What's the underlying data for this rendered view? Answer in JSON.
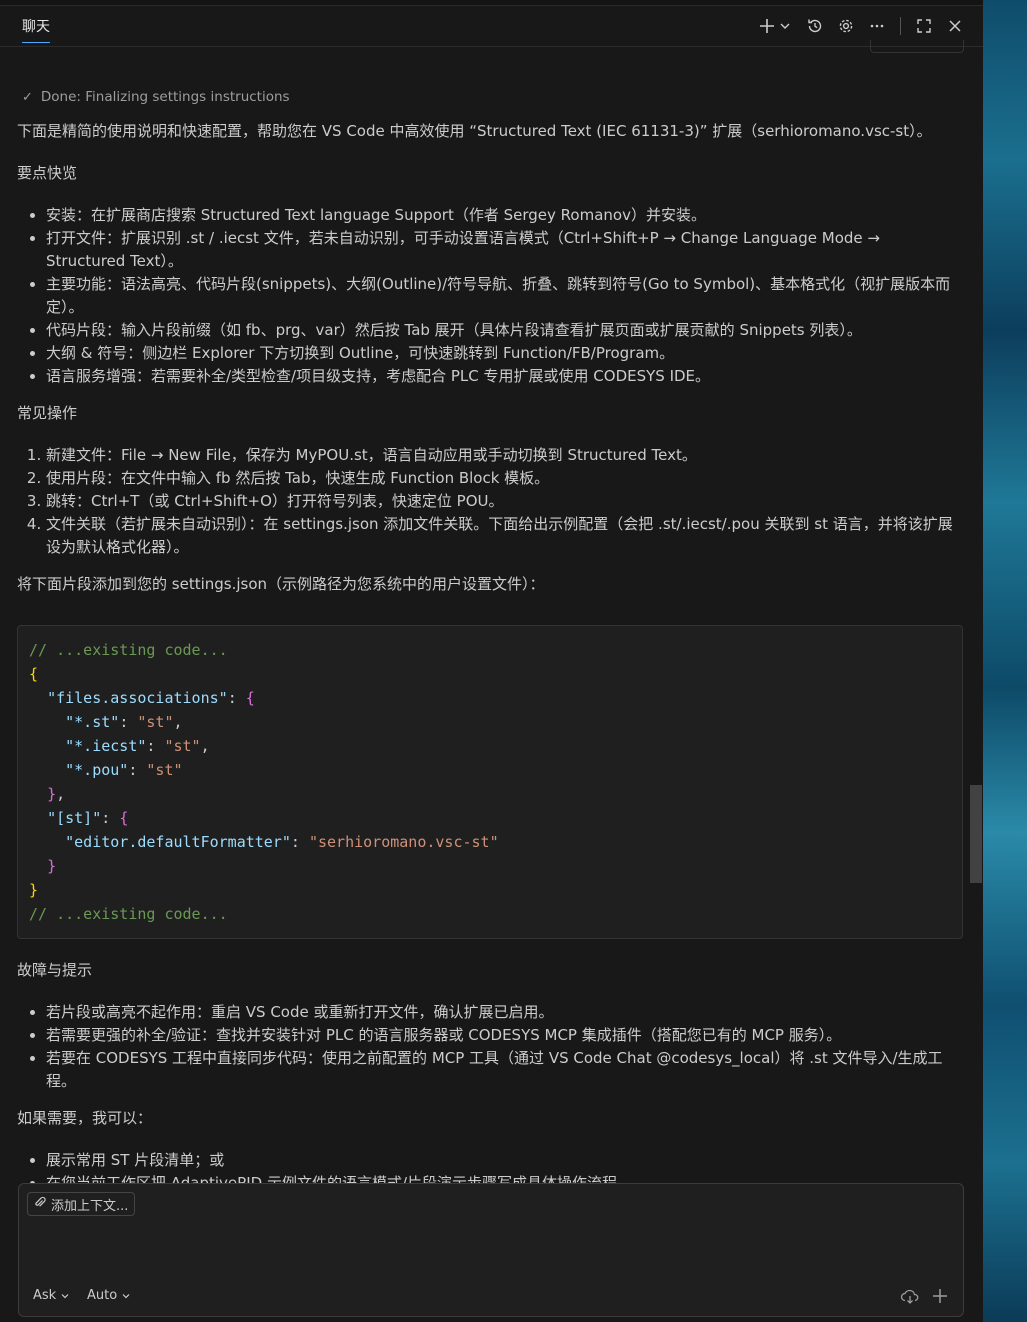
{
  "header": {
    "tab_label": "聊天"
  },
  "icons": [
    "plus-icon",
    "chevron-down-icon",
    "history-icon",
    "gear-icon",
    "more-icon",
    "maximize-icon",
    "close-icon",
    "check-icon",
    "paperclip-icon",
    "cloud-icon",
    "plus-icon"
  ],
  "status": {
    "done_text": "Done: Finalizing settings instructions"
  },
  "intro": "下面是精简的使用说明和快速配置，帮助您在 VS Code 中高效使用 “Structured Text (IEC 61131-3)” 扩展（serhioromano.vsc-st）。",
  "section1": {
    "title": "要点快览",
    "items": [
      "安装：在扩展商店搜索 Structured Text language Support（作者 Sergey Romanov）并安装。",
      "打开文件：扩展识别 .st / .iecst 文件，若未自动识别，可手动设置语言模式（Ctrl+Shift+P → Change Language Mode → Structured Text）。",
      "主要功能：语法高亮、代码片段(snippets)、大纲(Outline)/符号导航、折叠、跳转到符号(Go to Symbol)、基本格式化（视扩展版本而定）。",
      "代码片段：输入片段前缀（如 fb、prg、var）然后按 Tab 展开（具体片段请查看扩展页面或扩展贡献的 Snippets 列表）。",
      "大纲 & 符号：侧边栏 Explorer 下方切换到 Outline，可快速跳转到 Function/FB/Program。",
      "语言服务增强：若需要补全/类型检查/项目级支持，考虑配合 PLC 专用扩展或使用 CODESYS IDE。"
    ]
  },
  "section2": {
    "title": "常见操作",
    "items": [
      "新建文件：File → New File，保存为 MyPOU.st，语言自动应用或手动切换到 Structured Text。",
      "使用片段：在文件中输入 fb 然后按 Tab，快速生成 Function Block 模板。",
      "跳转：Ctrl+T（或 Ctrl+Shift+O）打开符号列表，快速定位 POU。",
      "文件关联（若扩展未自动识别）：在 settings.json 添加文件关联。下面给出示例配置（会把 .st/.iecst/.pou 关联到 st 语言，并将该扩展设为默认格式化器）。"
    ]
  },
  "code_intro": "将下面片段添加到您的 settings.json（示例路径为您系统中的用户设置文件）：",
  "code": {
    "comment": "// ...existing code...",
    "open_brace": "{",
    "close_brace": "}",
    "key_files_assoc": "\"files.associations\"",
    "key_st_ext": "\"*.st\"",
    "key_iecst_ext": "\"*.iecst\"",
    "key_pou_ext": "\"*.pou\"",
    "val_st": "\"st\"",
    "key_st_lang": "\"[st]\"",
    "key_formatter": "\"editor.defaultFormatter\"",
    "val_formatter": "\"serhioromano.vsc-st\""
  },
  "section3": {
    "title": "故障与提示",
    "items": [
      "若片段或高亮不起作用：重启 VS Code 或重新打开文件，确认扩展已启用。",
      "若需要更强的补全/验证：查找并安装针对 PLC 的语言服务器或 CODESYS MCP 集成插件（搭配您已有的 MCP 服务）。",
      "若要在 CODESYS 工程中直接同步代码：使用之前配置的 MCP 工具（通过 VS Code Chat @codesys_local）将 .st 文件导入/生成工程。"
    ]
  },
  "section4": {
    "title": "如果需要，我可以：",
    "items": [
      "展示常用 ST 片段清单；或",
      "在您当前工作区把 AdaptivePID 示例文件的语言模式/片段演示步骤写成具体操作流程。"
    ]
  },
  "input": {
    "add_context": "添加上下文...",
    "mode": "Ask",
    "model": "Auto"
  }
}
